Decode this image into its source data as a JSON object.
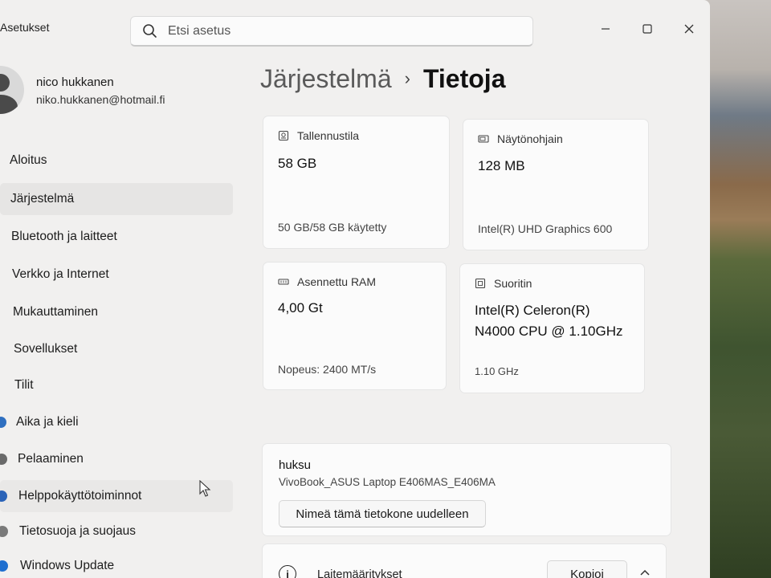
{
  "window": {
    "app_title": "Asetukset",
    "search_placeholder": "Etsi asetus"
  },
  "profile": {
    "name": "nico hukkanen",
    "email": "niko.hukkanen@hotmail.fi"
  },
  "nav": {
    "items": [
      {
        "label": "Aloitus"
      },
      {
        "label": "Järjestelmä"
      },
      {
        "label": "Bluetooth ja laitteet"
      },
      {
        "label": "Verkko ja Internet"
      },
      {
        "label": "Mukauttaminen"
      },
      {
        "label": "Sovellukset"
      },
      {
        "label": "Tilit"
      },
      {
        "label": "Aika ja kieli"
      },
      {
        "label": "Pelaaminen"
      },
      {
        "label": "Helppokäyttötoiminnot"
      },
      {
        "label": "Tietosuoja ja suojaus"
      },
      {
        "label": "Windows Update"
      }
    ],
    "selected": "Järjestelmä"
  },
  "breadcrumb": {
    "parent": "Järjestelmä",
    "separator": "›",
    "current": "Tietoja"
  },
  "cards": {
    "storage": {
      "label": "Tallennustila",
      "value": "58 GB",
      "sub": "50 GB/58 GB käytetty",
      "icon": "storage-icon"
    },
    "gpu": {
      "label": "Näytönohjain",
      "value": "128 MB",
      "sub": "Intel(R) UHD Graphics 600",
      "icon": "gpu-icon"
    },
    "ram": {
      "label": "Asennettu RAM",
      "value": "4,00 Gt",
      "sub": "Nopeus: 2400 MT/s",
      "icon": "ram-icon"
    },
    "cpu": {
      "label": "Suoritin",
      "value_line1": "Intel(R) Celeron(R)",
      "value_line2": "N4000 CPU @ 1.10GHz",
      "sub": "1.10 GHz",
      "icon": "cpu-icon"
    }
  },
  "device": {
    "name": "huksu",
    "model": "VivoBook_ASUS Laptop E406MAS_E406MA",
    "rename_label": "Nimeä tämä tietokone uudelleen"
  },
  "specs": {
    "title": "Laitemääritykset",
    "copy_label": "Kopioi"
  },
  "colors": {
    "window_bg": "#f1f0ef",
    "card_bg": "#fbfbfb",
    "selected_nav": "#e6e5e4"
  }
}
